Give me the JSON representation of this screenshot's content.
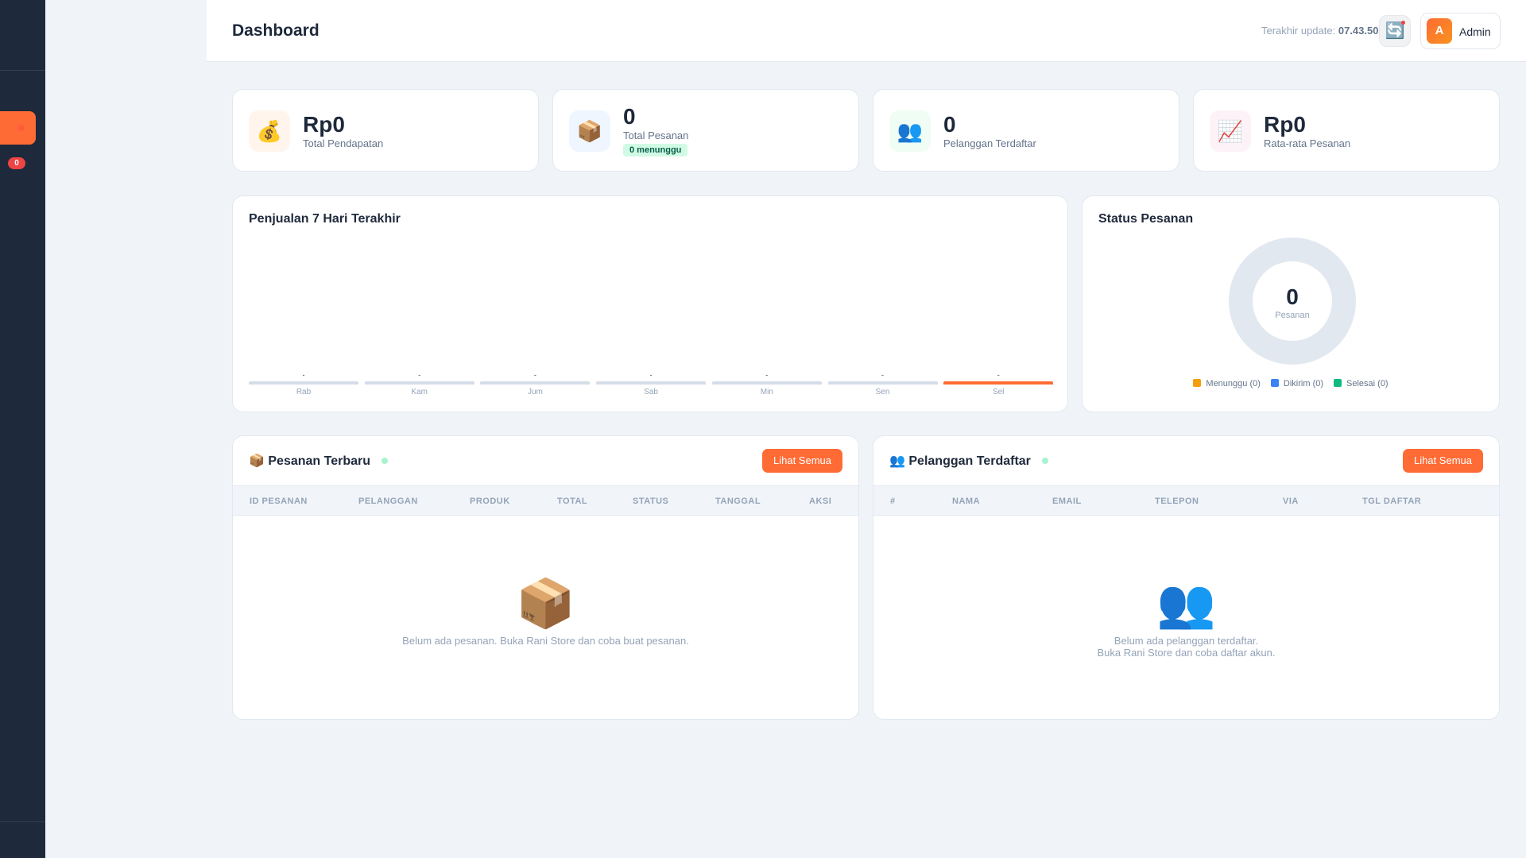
{
  "sidebar": {
    "badge": "0"
  },
  "header": {
    "title": "Dashboard",
    "update_label": "Terakhir update:",
    "update_time": "07.43.50",
    "refresh_icon": "refresh-icon",
    "avatar_initial": "A",
    "user": "Admin"
  },
  "stats": [
    {
      "icon": "💰",
      "value": "Rp0",
      "label": "Total Pendapatan"
    },
    {
      "icon": "📦",
      "value": "0",
      "label": "Total Pesanan",
      "badge": "0 menunggu"
    },
    {
      "icon": "👥",
      "value": "0",
      "label": "Pelanggan Terdaftar"
    },
    {
      "icon": "📈",
      "value": "Rp0",
      "label": "Rata-rata Pesanan"
    }
  ],
  "sales_chart": {
    "title": "Penjualan 7 Hari Terakhir"
  },
  "chart_data": {
    "type": "bar",
    "title": "Penjualan 7 Hari Terakhir",
    "categories": [
      "Rab",
      "Kam",
      "Jum",
      "Sab",
      "Min",
      "Sen",
      "Sel"
    ],
    "values": [
      0,
      0,
      0,
      0,
      0,
      0,
      0
    ],
    "value_labels": [
      "-",
      "-",
      "-",
      "-",
      "-",
      "-",
      "-"
    ],
    "highlight": "Sel",
    "colors": {
      "default": "#d5dde8",
      "highlight": "#ff6b35"
    }
  },
  "status": {
    "title": "Status Pesanan",
    "total": "0",
    "total_label": "Pesanan",
    "legend": [
      {
        "label": "Menunggu (0)",
        "color": "#f59e0b"
      },
      {
        "label": "Dikirim (0)",
        "color": "#3b82f6"
      },
      {
        "label": "Selesai (0)",
        "color": "#10b981"
      }
    ]
  },
  "orders": {
    "icon": "📦",
    "title": "Pesanan Terbaru",
    "button": "Lihat Semua",
    "columns": [
      "ID PESANAN",
      "PELANGGAN",
      "PRODUK",
      "TOTAL",
      "STATUS",
      "TANGGAL",
      "AKSI"
    ],
    "empty_icon": "📦",
    "empty_text": "Belum ada pesanan. Buka Rani Store dan coba buat pesanan."
  },
  "customers": {
    "icon": "👥",
    "title": "Pelanggan Terdaftar",
    "button": "Lihat Semua",
    "columns": [
      "#",
      "NAMA",
      "EMAIL",
      "TELEPON",
      "VIA",
      "TGL DAFTAR"
    ],
    "empty_icon": "👥",
    "empty_text_1": "Belum ada pelanggan terdaftar.",
    "empty_text_2": "Buka Rani Store dan coba daftar akun."
  }
}
